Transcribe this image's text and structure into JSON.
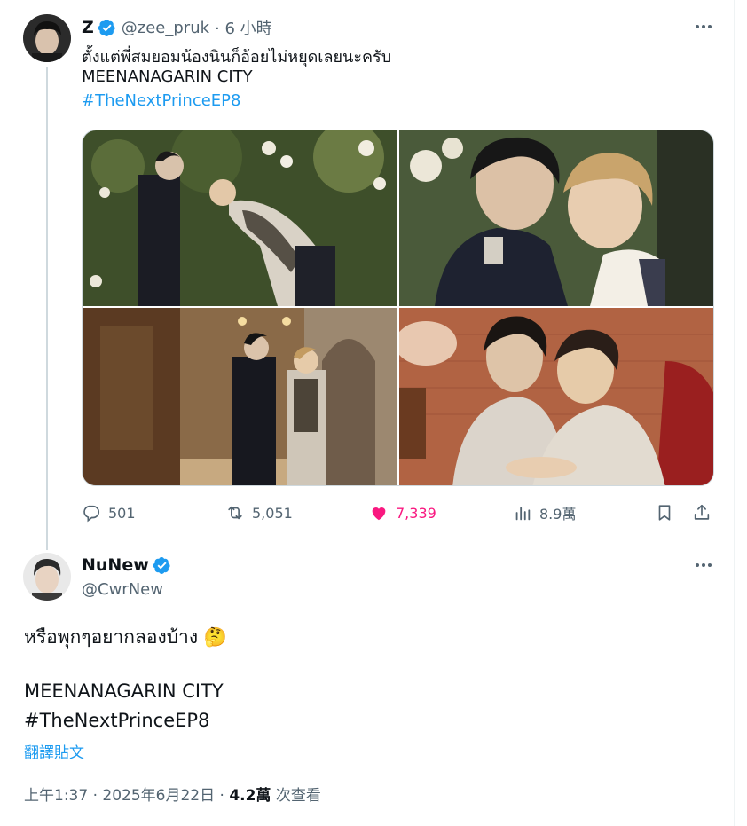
{
  "first_tweet": {
    "author_name": "Z",
    "author_handle": "@zee_pruk",
    "time": "· 6 小時",
    "text_line1": "ตั้งแต่พี่สมยอมน้องนินก็อ้อยไม่หยุดเลยนะครับ",
    "text_line2": "MEENANAGARIN CITY",
    "hashtag": "#TheNextPrinceEP8",
    "counts": {
      "replies": "501",
      "reposts": "5,051",
      "likes": "7,339",
      "views": "8.9萬"
    }
  },
  "reply_tweet": {
    "author_name": "NuNew",
    "author_handle": "@CwrNew",
    "text_line1": "หรือพุกๆอยากลองบ้าง 🤔",
    "text_line2": "MEENANAGARIN CITY",
    "hashtag": "#TheNextPrinceEP8",
    "translate_label": "翻譯貼文",
    "timestamp": "上午1:37 · 2025年6月22日 · ",
    "views_count": "4.2萬",
    "views_label": " 次查看"
  },
  "colors": {
    "accent": "#1d9bf0",
    "like": "#f91880",
    "secondary_text": "#536471"
  },
  "icons": [
    "verified-badge-icon",
    "more-icon",
    "reply-icon",
    "repost-icon",
    "like-icon",
    "views-icon",
    "bookmark-icon",
    "share-icon"
  ]
}
